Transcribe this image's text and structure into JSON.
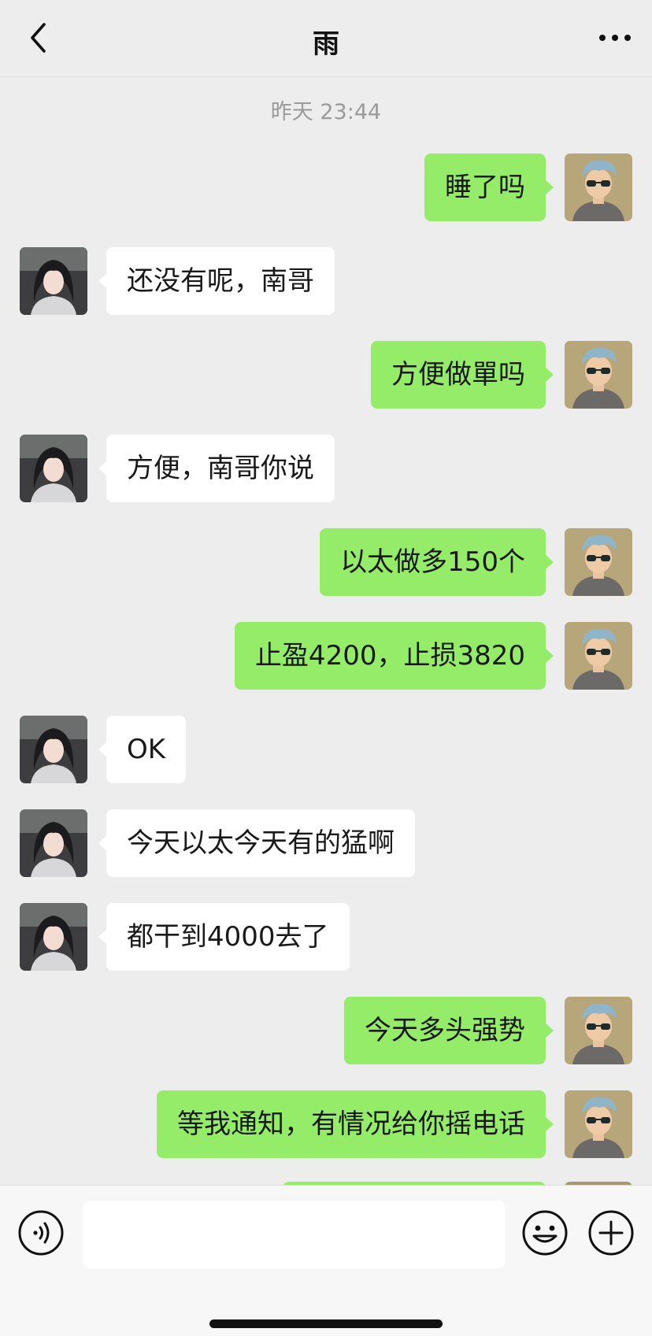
{
  "header": {
    "title": "雨"
  },
  "timestamp": "昨天 23:44",
  "messages": [
    {
      "side": "right",
      "text": "睡了吗"
    },
    {
      "side": "left",
      "text": "还没有呢，南哥"
    },
    {
      "side": "right",
      "text": "方便做單吗"
    },
    {
      "side": "left",
      "text": "方便，南哥你说"
    },
    {
      "side": "right",
      "text": "以太做多150个"
    },
    {
      "side": "right",
      "text": "止盈4200，止损3820"
    },
    {
      "side": "left",
      "text": "OK"
    },
    {
      "side": "left",
      "text": "今天以太今天有的猛啊"
    },
    {
      "side": "left",
      "text": "都干到4000去了"
    },
    {
      "side": "right",
      "text": "今天多头强势"
    },
    {
      "side": "right",
      "text": "等我通知，有情况给你摇电话"
    }
  ],
  "input": {
    "value": ""
  },
  "icons": {
    "back": "chevron-left-icon",
    "more": "more-dots-icon",
    "voice": "voice-icon",
    "emoji": "emoji-icon",
    "plus": "plus-icon"
  },
  "colors": {
    "sent_bubble": "#95ec69",
    "received_bubble": "#ffffff",
    "background": "#ededed"
  }
}
